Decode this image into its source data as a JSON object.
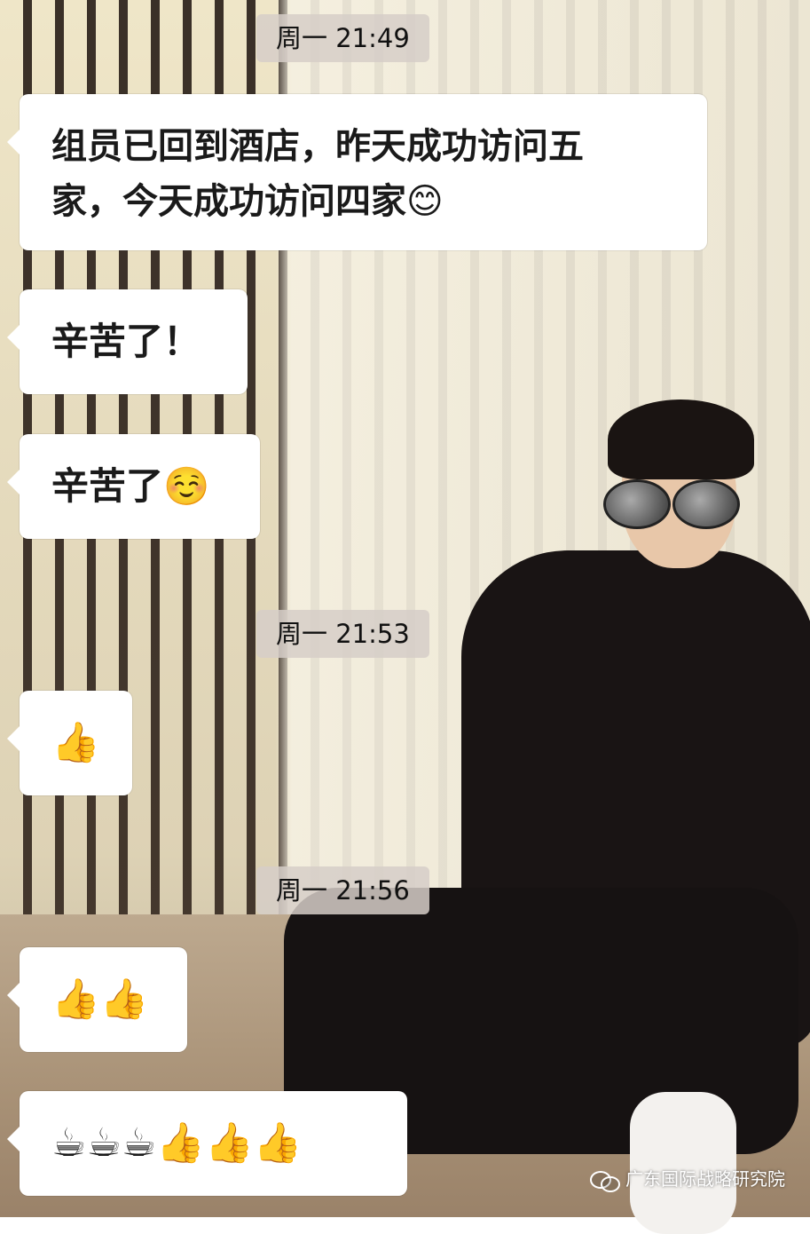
{
  "timestamps": [
    "周一 21:49",
    "周一 21:53",
    "周一 21:56"
  ],
  "messages": [
    {
      "line1": "组员已回到酒店，昨天成功访问五",
      "line2": "家，今天成功访问四家",
      "emoji": "😊"
    },
    {
      "text": "辛苦了！"
    },
    {
      "text": "辛苦了",
      "emoji": "☺️"
    },
    {
      "emoji": "👍"
    },
    {
      "emoji": "👍👍"
    },
    {
      "emoji": "☕☕☕👍👍👍"
    }
  ],
  "watermark": "广东国际战略研究院",
  "icons": {
    "watermark": "wechat-icon"
  }
}
